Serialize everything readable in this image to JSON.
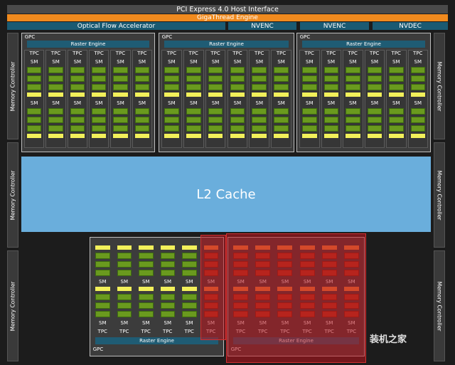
{
  "header": {
    "pcie": "PCI Express 4.0 Host Interface",
    "gigathread": "GigaThread Engine",
    "optical_flow": "Optical Flow Accelerator",
    "nvenc": "NVENC",
    "nvdec": "NVDEC"
  },
  "memory_controller": "Memory Controller",
  "l2_cache": "L2 Cache",
  "gpc_label": "GPC",
  "raster_engine": "Raster Engine",
  "tpc_label": "TPC",
  "sm_label": "SM",
  "watermark": "装机之家",
  "colors": {
    "cuda_core": "#6a9a1e",
    "l1_cache": "#f2f05a",
    "disabled_core": "#b0391e",
    "disabled_l1": "#f08a3a",
    "raster": "#1f5c74",
    "l2": "#6aaedc",
    "highlight": "#be141e"
  }
}
